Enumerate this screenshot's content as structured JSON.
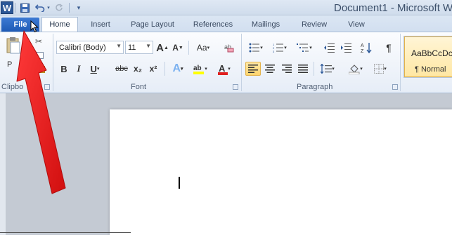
{
  "titlebar": {
    "logo_letter": "W",
    "title": "Document1 - Microsoft W"
  },
  "quick_access": [
    {
      "icon": "save-icon",
      "glyph": "💾"
    },
    {
      "icon": "undo-icon",
      "glyph": "↶"
    },
    {
      "icon": "redo-icon",
      "glyph": "↻"
    },
    {
      "icon": "customize-icon",
      "glyph": "▾"
    }
  ],
  "tabs": [
    "File",
    "Home",
    "Insert",
    "Page Layout",
    "References",
    "Mailings",
    "Review",
    "View"
  ],
  "ribbon": {
    "clipboard": {
      "paste_partial": "P",
      "label": "Clipbo"
    },
    "font": {
      "name": "Calibri (Body)",
      "size": "11",
      "label": "Font",
      "buttons": {
        "bold": "B",
        "italic": "I",
        "underline": "U",
        "strike": "abc",
        "subscript": "x₂",
        "superscript": "x²",
        "grow": "A",
        "shrink": "A",
        "case": "Aa"
      }
    },
    "paragraph": {
      "label": "Paragraph",
      "pilcrow": "¶"
    },
    "styles": {
      "preview": "AaBbCcDc",
      "name": "¶ Normal"
    }
  },
  "colors": {
    "file_tab": "#2b6acb",
    "highlight": "#ffff00",
    "font_color": "#e02020",
    "arrow": "#e51a1a"
  }
}
